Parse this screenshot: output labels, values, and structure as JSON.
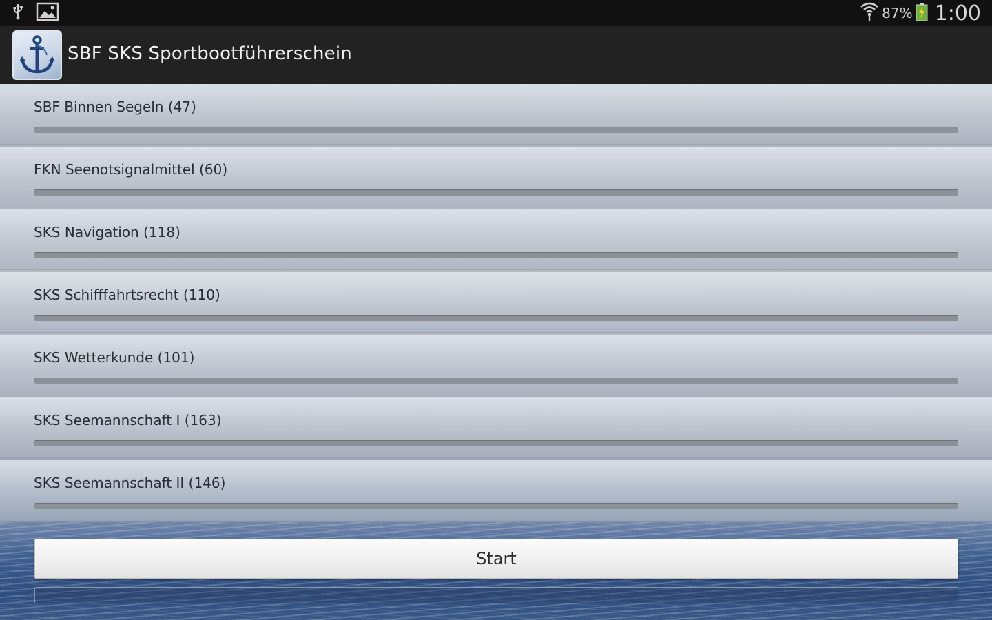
{
  "status_bar": {
    "left_icons": [
      "usb-icon",
      "image-icon"
    ],
    "wifi_icon": "wifi-icon",
    "battery_percent": "87%",
    "battery_icon": "battery-charging-icon",
    "time": "1:00"
  },
  "action_bar": {
    "app_icon": "anchor-icon",
    "title": "SBF SKS Sportbootführerschein"
  },
  "topics": [
    {
      "label": "SBF Binnen Segeln (47)",
      "progress": 0
    },
    {
      "label": "FKN Seenotsignalmittel (60)",
      "progress": 0
    },
    {
      "label": "SKS Navigation (118)",
      "progress": 0
    },
    {
      "label": "SKS Schifffahrtsrecht (110)",
      "progress": 0
    },
    {
      "label": "SKS Wetterkunde (101)",
      "progress": 0
    },
    {
      "label": "SKS Seemannschaft I (163)",
      "progress": 0
    },
    {
      "label": "SKS Seemannschaft II (146)",
      "progress": 0
    }
  ],
  "start_button": {
    "label": "Start"
  },
  "colors": {
    "progress_fill": "#33b5e5",
    "action_bar": "#222222"
  }
}
